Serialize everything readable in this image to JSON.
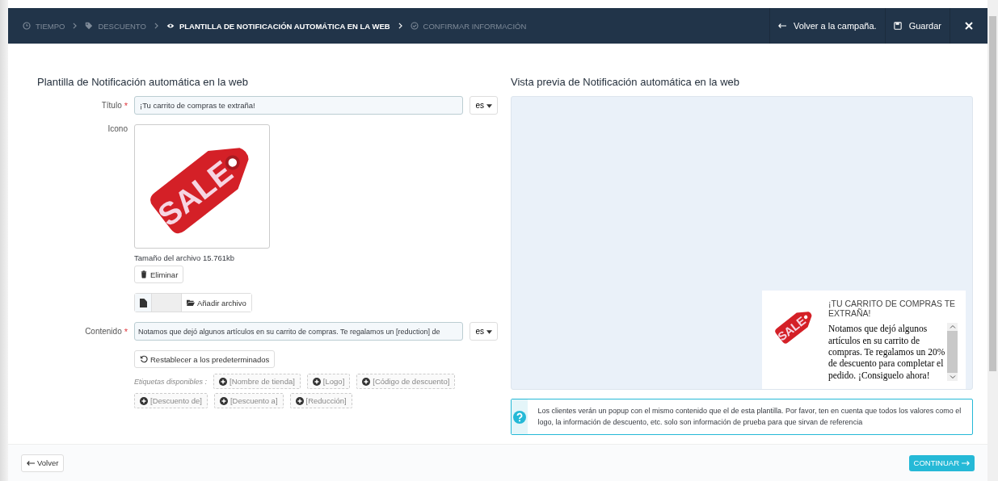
{
  "steps": [
    {
      "label": "TIEMPO",
      "selected": false
    },
    {
      "label": "DESCUENTO",
      "selected": false
    },
    {
      "label": "PLANTILLA DE NOTIFICACIÓN AUTOMÁTICA EN LA WEB",
      "selected": true
    },
    {
      "label": "CONFIRMAR INFORMACIÓN",
      "selected": false
    }
  ],
  "top_actions": {
    "back": "Volver a la campaña.",
    "save": "Guardar"
  },
  "form": {
    "heading": "Plantilla de Notificación automática en la web",
    "title_label": "Título",
    "title_value": "¡Tu carrito de compras te extraña!",
    "title_lang": "es",
    "required_mark": "*",
    "icon_label": "Icono",
    "icon_text": "SALE",
    "file_size": "Tamaño del archivo 15.761kb",
    "delete": "Eliminar",
    "add_file": "Añadir archivo",
    "content_label": "Contenido",
    "content_value": "Notamos que dejó algunos artículos en su carrito de compras. Te regalamos un [reduction] de",
    "content_lang": "es",
    "reset": "Restablecer a los predeterminados",
    "tags_label": "Etiquetas disponibles :",
    "tags": [
      "[Nombre de tienda]",
      "[Logo]",
      "[Código de descuento]",
      "[Descuento de]",
      "[Descuento a]",
      "[Reducción]"
    ]
  },
  "preview": {
    "heading": "Vista previa de Notificación automática en la web",
    "popup_icon_text": "SALE",
    "popup_title": "¡TU CARRITO DE COMPRAS TE EXTRAÑA!",
    "popup_text": "Notamos que dejó algunos artículos en su carrito de compras. Te regalamos un 20% de descuento para completar el pedido. ¡Consiguelo ahora!",
    "info": "Los clientes verán un popup con el mismo contenido que el de esta plantilla. Por favor, ten en cuenta que todos los valores como el logo, la información de descuento, etc. solo son información de prueba para que sirvan de referencia"
  },
  "footer": {
    "back": "Volver",
    "continue": "CONTINUAR"
  }
}
